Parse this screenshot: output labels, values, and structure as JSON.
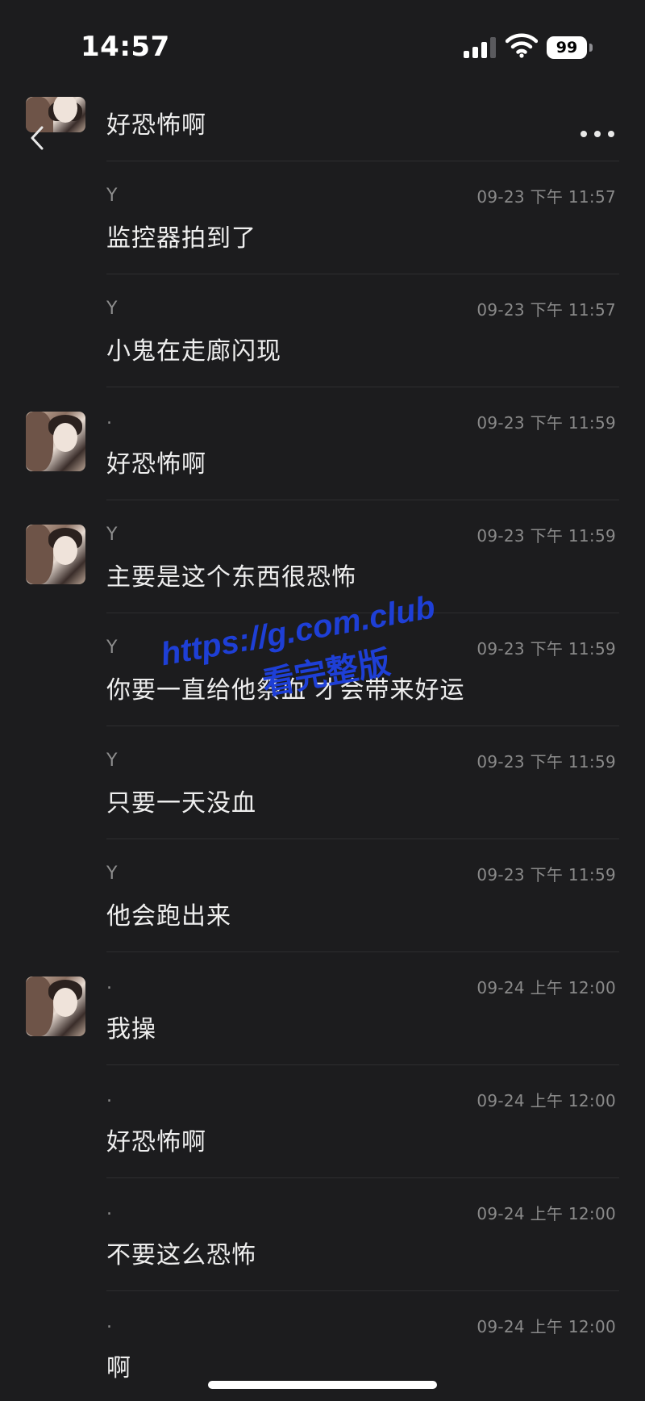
{
  "status_bar": {
    "time": "14:57",
    "battery_level": "99",
    "signal_bars": 3,
    "signal_bars_total": 4
  },
  "header": {
    "back_icon": "chevron-left-icon",
    "more_icon": "more-horizontal-icon"
  },
  "messages": [
    {
      "sender": "",
      "time": "",
      "text": "好恐怖啊",
      "avatar": true
    },
    {
      "sender": "Y",
      "time": "09-23 下午 11:57",
      "text": "监控器拍到了",
      "avatar": false
    },
    {
      "sender": "Y",
      "time": "09-23 下午 11:57",
      "text": "小鬼在走廊闪现",
      "avatar": false
    },
    {
      "sender": ".",
      "time": "09-23 下午 11:59",
      "text": "好恐怖啊",
      "avatar": true
    },
    {
      "sender": "Y",
      "time": "09-23 下午 11:59",
      "text": "主要是这个东西很恐怖",
      "avatar": true
    },
    {
      "sender": "Y",
      "time": "09-23 下午 11:59",
      "text": "你要一直给他祭血 才会带来好运",
      "avatar": false
    },
    {
      "sender": "Y",
      "time": "09-23 下午 11:59",
      "text": "只要一天没血",
      "avatar": false
    },
    {
      "sender": "Y",
      "time": "09-23 下午 11:59",
      "text": "他会跑出来",
      "avatar": false
    },
    {
      "sender": ".",
      "time": "09-24 上午 12:00",
      "text": "我操",
      "avatar": true
    },
    {
      "sender": ".",
      "time": "09-24 上午 12:00",
      "text": "好恐怖啊",
      "avatar": false
    },
    {
      "sender": ".",
      "time": "09-24 上午 12:00",
      "text": "不要这么恐怖",
      "avatar": false
    },
    {
      "sender": ".",
      "time": "09-24 上午 12:00",
      "text": "啊",
      "avatar": false
    }
  ],
  "watermark": {
    "url": "https://g.com.club",
    "caption": "看完整版"
  },
  "colors": {
    "background": "#1c1c1e",
    "text": "#eeeeee",
    "meta_text": "#8a8a8a",
    "divider": "#2e2e30",
    "watermark": "#1e3fd6"
  }
}
